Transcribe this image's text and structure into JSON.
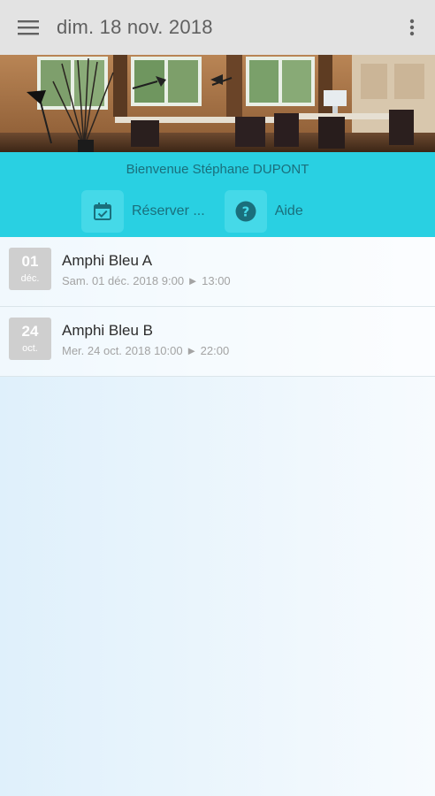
{
  "appbar": {
    "title": "dim. 18 nov. 2018",
    "menu_icon": "hamburger-menu-icon",
    "more_icon": "more-vertical-icon"
  },
  "hero": {
    "image": "office-interior-photo"
  },
  "header": {
    "welcome": "Bienvenue Stéphane DUPONT",
    "actions": [
      {
        "label": "Réserver ...",
        "icon": "calendar-check-icon"
      },
      {
        "label": "Aide",
        "icon": "help-circle-icon"
      }
    ]
  },
  "bookings": [
    {
      "day": "01",
      "month": "déc.",
      "room": "Amphi Bleu A",
      "when": "Sam. 01 déc. 2018 9:00 ► 13:00"
    },
    {
      "day": "24",
      "month": "oct.",
      "room": "Amphi Bleu B",
      "when": "Mer. 24 oct. 2018 10:00 ► 22:00"
    }
  ],
  "colors": {
    "appbar": "#e3e3e3",
    "accent": "#29d0e2",
    "accent_text": "#1a6f7c",
    "date_badge": "#cfcfcf"
  }
}
